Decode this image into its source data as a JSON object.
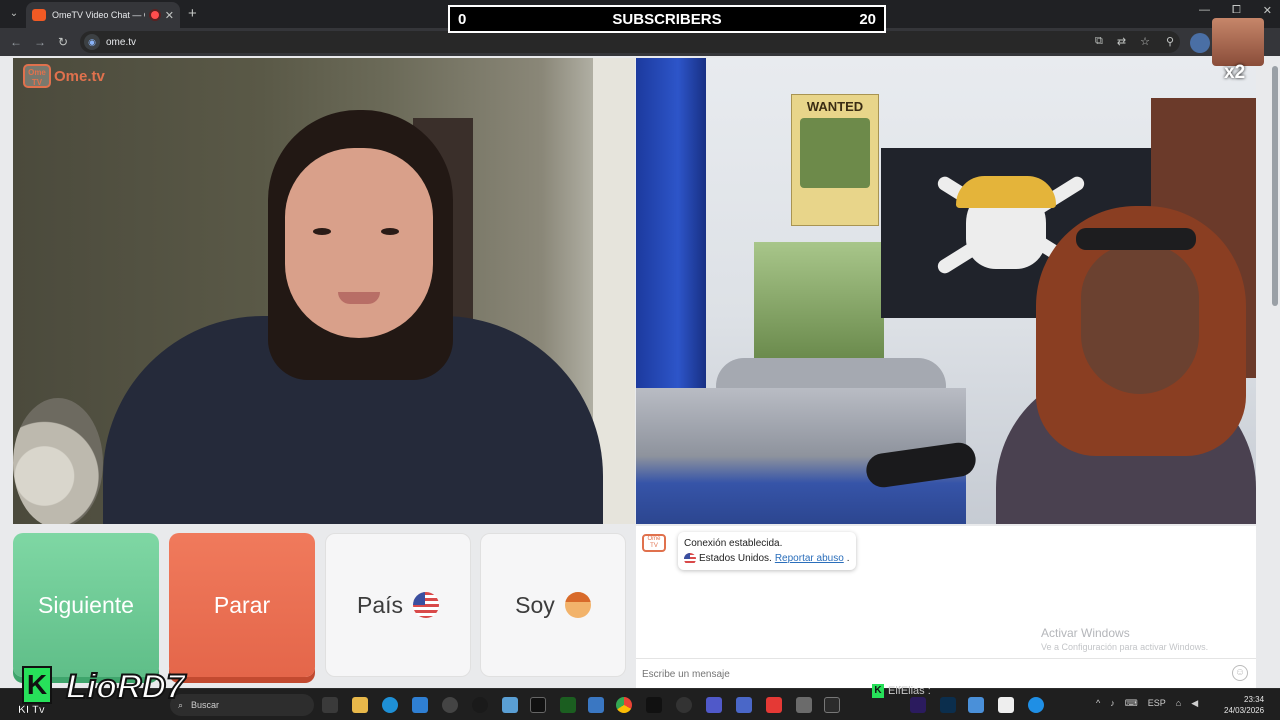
{
  "browser": {
    "tab_title": "OmeTV Video Chat — Ome",
    "new_tab": "+",
    "url": "ome.tv",
    "win_min": "—",
    "win_max": "⧠",
    "win_close": "✕"
  },
  "overlay": {
    "subs_left": "0",
    "subs_title": "SUBSCRIBERS",
    "subs_right": "20",
    "multiplier": "x2"
  },
  "site": {
    "logo_badge": "Ome TV",
    "logo_text": "Ome.tv"
  },
  "buttons": {
    "next": "Siguiente",
    "stop": "Parar",
    "country": "País",
    "gender": "Soy"
  },
  "chat": {
    "avatar_label": "Ome TV",
    "status": "Conexión establecida.",
    "country": "Estados Unidos.",
    "report": "Reportar abuso",
    "report_period": ".",
    "input_placeholder": "Escribe un mensaje",
    "activate_title": "Activar Windows",
    "activate_sub": "Ve a Configuración para activar Windows."
  },
  "taskbar": {
    "search_placeholder": "Buscar",
    "lang": "ESP",
    "time": "23:34",
    "date": "24/03/2026"
  },
  "watermark": {
    "k": "K",
    "name": "LioRD7",
    "sub": "KI Tv",
    "viewer": "ElfElias :"
  }
}
